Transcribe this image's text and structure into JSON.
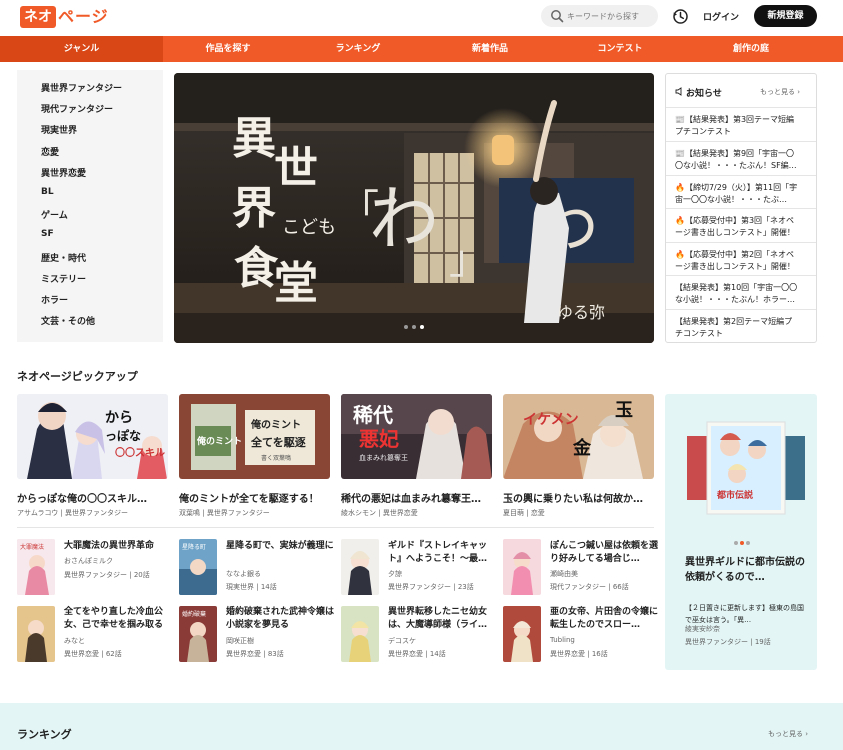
{
  "header": {
    "logo_box": "ネオ",
    "logo_rest": "ページ",
    "search_placeholder": "キーワードから探す",
    "login": "ログイン",
    "register": "新規登録"
  },
  "nav": [
    "ジャンル",
    "作品を探す",
    "ランキング",
    "新着作品",
    "コンテスト",
    "創作の庭"
  ],
  "genres": [
    "異世界ファンタジー",
    "現代ファンタジー",
    "現実世界",
    "恋愛",
    "異世界恋愛",
    "BL",
    "ゲーム",
    "SF",
    "歴史・時代",
    "ミステリー",
    "ホラー",
    "文芸・その他"
  ],
  "hero": {
    "title_vertical": "異世界こども食堂",
    "center_char": "わ",
    "noren_char": "わ",
    "author": "ゆる弥",
    "slide_count": 3,
    "active_slide": 3
  },
  "news": {
    "title": "お知らせ",
    "more": "もっと見る ›",
    "items": [
      {
        "icon": "📰",
        "line1": "【結果発表】第3回テーマ短編",
        "line2": "プチコンテスト"
      },
      {
        "icon": "📰",
        "line1": "【結果発表】第9回「宇宙一〇",
        "line2": "〇な小説！・・・たぶん！SF編…"
      },
      {
        "icon": "🔥",
        "line1": "【締切7/29（火）】第11回「宇",
        "line2": "宙一〇〇な小説！・・・たぶ…"
      },
      {
        "icon": "🔥",
        "line1": "【応募受付中】第3回「ネオペ",
        "line2": "ージ書き出しコンテスト」開催！"
      },
      {
        "icon": "🔥",
        "line1": "【応募受付中】第2回「ネオペ",
        "line2": "ージ書き出しコンテスト」開催！"
      },
      {
        "icon": "",
        "line1": "【結果発表】第10回「宇宙一〇〇",
        "line2": "な小説！・・・たぶん！ホラー…"
      },
      {
        "icon": "",
        "line1": "【結果発表】第2回テーマ短編プ",
        "line2": "チコンテスト"
      }
    ]
  },
  "pickup": {
    "title": "ネオページピックアップ",
    "items": [
      {
        "title": "からっぽな俺の〇〇スキル…",
        "author": "アサムラコウ",
        "genre": "異世界ファンタジー",
        "cover_text": "からっぽな俺の〇〇スキル"
      },
      {
        "title": "俺のミントが全てを駆逐する！",
        "author": "双葉鳴",
        "genre": "異世界ファンタジー",
        "cover_text": "俺のミントが全てを駆逐する"
      },
      {
        "title": "稀代の悪妃は血まみれ簒奪王…",
        "author": "綾水シモン",
        "genre": "異世界恋愛",
        "cover_text": "稀代の悪妃"
      },
      {
        "title": "玉の輿に乗りたい私は何故か…",
        "author": "夏目萌",
        "genre": "恋愛",
        "cover_text": "玉の輿に乗りたい"
      }
    ],
    "small": [
      {
        "title": "大罪魔法の異世界革命",
        "author": "おさんぽミルク",
        "genre": "異世界ファンタジー",
        "episodes": "20話"
      },
      {
        "title": "星降る町で、実妹が義理に",
        "author": "ななよ銀る",
        "genre": "現実世界",
        "episodes": "14話"
      },
      {
        "title": "ギルド『ストレイキャット』へようこそ！〜最…",
        "author": "夕諒",
        "genre": "異世界ファンタジー",
        "episodes": "23話"
      },
      {
        "title": "ぽんこつ鍼い屋は依頼を選り好みしてる場合じ…",
        "author": "瀬崎由美",
        "genre": "現代ファンタジー",
        "episodes": "66話"
      },
      {
        "title": "全てをやり直した冷血公女、己で幸せを掴み取る",
        "author": "みなと",
        "genre": "異世界恋愛",
        "episodes": "62話"
      },
      {
        "title": "婚約破棄された武神令嬢は小説家を夢見る",
        "author": "岡咲正樹",
        "genre": "異世界恋愛",
        "episodes": "83話"
      },
      {
        "title": "異世界転移したニセ幼女は、大魔導師様（ライ…",
        "author": "デコスケ",
        "genre": "異世界恋愛",
        "episodes": "14話"
      },
      {
        "title": "亜の女帝、片田舎の令嬢に転生したのでスロー…",
        "author": "Tubling",
        "genre": "異世界恋愛",
        "episodes": "16話"
      }
    ]
  },
  "feature": {
    "title": "異世界ギルドに都市伝説の依頼がくるので…",
    "desc": "【２日置きに更新します】極東の島国で巫女は言う。「異…",
    "author": "綾実安紗奈",
    "genre": "異世界ファンタジー",
    "episodes": "19話"
  },
  "ranking": {
    "title": "ランキング",
    "more": "もっと見る ›"
  },
  "colors": {
    "accent": "#f05a28",
    "nav_active": "#d94716",
    "feature_bg": "#e3f5f5"
  }
}
